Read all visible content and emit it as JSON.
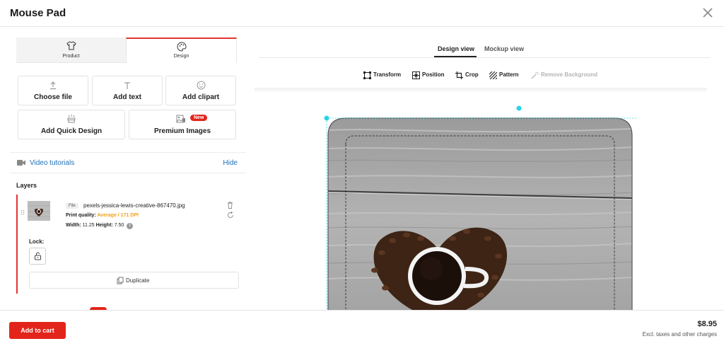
{
  "header": {
    "title": "Mouse Pad"
  },
  "tabs": [
    {
      "label": "Product",
      "icon": "tshirt-icon"
    },
    {
      "label": "Design",
      "icon": "palette-icon"
    }
  ],
  "actions": {
    "choose_file": "Choose file",
    "add_text": "Add text",
    "add_clipart": "Add clipart",
    "add_quick_design": "Add Quick Design",
    "premium_images": "Premium Images",
    "new_badge": "New"
  },
  "video": {
    "label": "Video tutorials",
    "hide": "Hide"
  },
  "layers": {
    "title": "Layers",
    "item": {
      "file_tag": "File",
      "file_name": "pexels-jessica-lewis-creative-867470.jpg",
      "print_quality_label": "Print quality:",
      "print_quality_value": "Average / 171 DPI",
      "width_label": "Width:",
      "width_value": "11.25",
      "height_label": "Height:",
      "height_value": "7.50",
      "info": "i"
    },
    "lock_label": "Lock:",
    "duplicate": "Duplicate"
  },
  "view_tabs": {
    "design": "Design view",
    "mockup": "Mockup view"
  },
  "tools": {
    "transform": "Transform",
    "position": "Position",
    "crop": "Crop",
    "pattern": "Pattern",
    "remove_background": "Remove Background"
  },
  "footer": {
    "add_to_cart": "Add to cart",
    "price": "$8.95",
    "price_note": "Excl. taxes and other charges"
  },
  "colors": {
    "accent": "#e3241b",
    "link": "#1e6fb8",
    "quality_warning": "#f0a21c",
    "handle": "#29d3e8"
  }
}
